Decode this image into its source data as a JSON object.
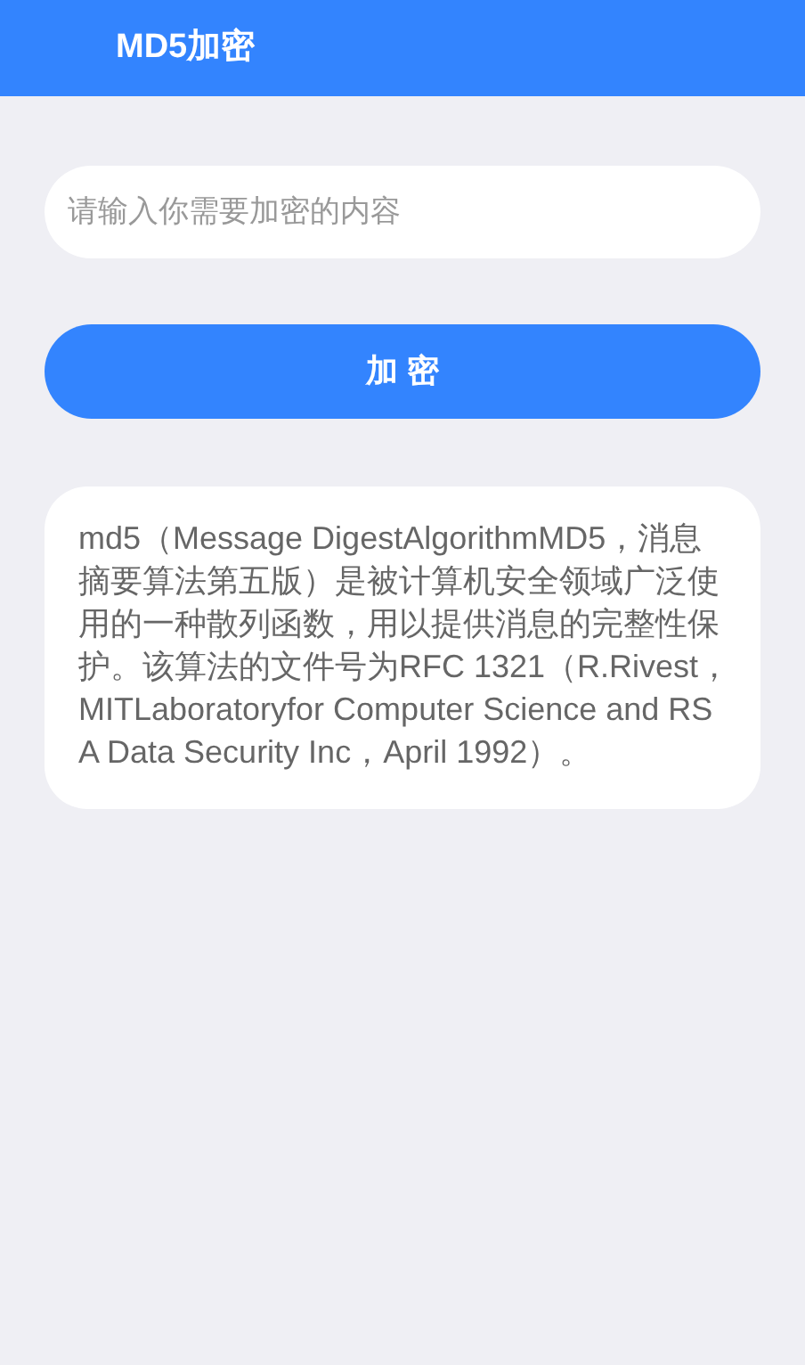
{
  "app_bar": {
    "title": "MD5加密"
  },
  "input": {
    "placeholder": "请输入你需要加密的内容"
  },
  "encrypt_button": {
    "label": "加 密"
  },
  "description": "md5（Message DigestAlgorithmMD5，消息摘要算法第五版）是被计算机安全领域广泛使用的一种散列函数，用以提供消息的完整性保护。该算法的文件号为RFC 1321（R.Rivest，MITLaboratoryfor Computer Science and RSA Data Security Inc，April 1992）。"
}
